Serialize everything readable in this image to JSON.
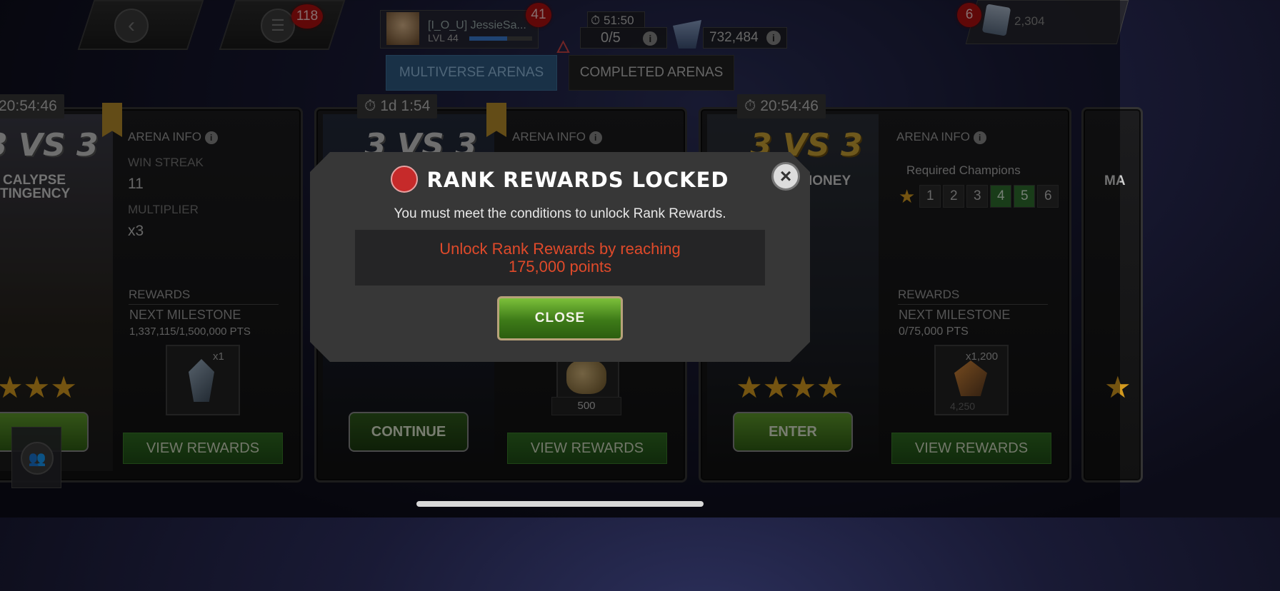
{
  "topbar": {
    "back_icon": "chevron-left-icon",
    "menu_icon": "menu-icon",
    "menu_badge": "118",
    "profile": {
      "name": "[I_O_U] JessieSa...",
      "level": "LVL 44",
      "xp_fraction": 0.6,
      "badge": "41"
    },
    "energy": {
      "timer": "51:50",
      "value": "0/5"
    },
    "gold": {
      "value": "732,484"
    },
    "units": {
      "badge": "6",
      "value": "2,304"
    }
  },
  "tabs": {
    "multiverse": "MULTIVERSE ARENAS",
    "completed": "COMPLETED ARENAS"
  },
  "cards": [
    {
      "timer": "20:54:46",
      "vs": "3 VS 3",
      "title_line1": "CALYPSE",
      "title_line2": "TINGENCY",
      "arena_info": "ARENA INFO",
      "win_streak_label": "WIN STREAK",
      "win_streak": "11",
      "multiplier_label": "MULTIPLIER",
      "multiplier": "x3",
      "rewards_label": "REWARDS",
      "next_milestone_label": "NEXT MILESTONE",
      "milestone_pts": "1,337,115/1,500,000 PTS",
      "reward_qty": "x1",
      "view_rewards": "VIEW REWARDS"
    },
    {
      "timer": "1d 1:54",
      "vs": "3 VS 3",
      "arena_info": "ARENA INFO",
      "reward_qty": "500",
      "continue": "CONTINUE",
      "view_rewards": "VIEW REWARDS"
    },
    {
      "timer": "20:54:46",
      "vs": "3 VS 3",
      "title_line1": "IONEY",
      "arena_info": "ARENA INFO",
      "required_champions": "Required Champions",
      "required_numbers": [
        "1",
        "2",
        "3",
        "4",
        "5",
        "6"
      ],
      "rewards_label": "REWARDS",
      "next_milestone_label": "NEXT MILESTONE",
      "milestone_pts": "0/75,000 PTS",
      "reward_qty": "x1,200",
      "reward_sub": "4,250",
      "enter": "ENTER",
      "view_rewards": "VIEW REWARDS"
    }
  ],
  "edge_card_title": "MA",
  "modal": {
    "title": "RANK REWARDS LOCKED",
    "message": "You must meet the conditions to unlock Rank Rewards.",
    "unlock_line1": "Unlock Rank Rewards by reaching",
    "unlock_line2": "175,000 points",
    "close_label": "CLOSE",
    "close_x": "×"
  },
  "colors": {
    "accent_green": "#3d7a18",
    "unlock_red": "#e04a2a",
    "badge_red": "#b01010",
    "star_gold": "#d39a1f"
  }
}
